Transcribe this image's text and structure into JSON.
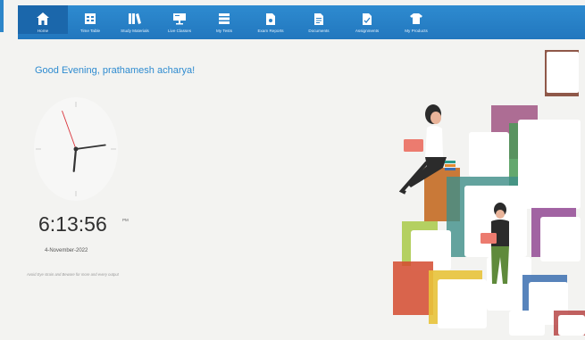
{
  "nav": {
    "items": [
      {
        "label": "Home",
        "icon": "home-icon",
        "active": true
      },
      {
        "label": "Time Table",
        "icon": "timetable-icon",
        "active": false
      },
      {
        "label": "Study Materials",
        "icon": "books-icon",
        "active": false
      },
      {
        "label": "Live Classes",
        "icon": "presentation-icon",
        "active": false
      },
      {
        "label": "My Tests",
        "icon": "tests-icon",
        "active": false
      },
      {
        "label": "Exam Reports",
        "icon": "report-icon",
        "active": false
      },
      {
        "label": "Documents",
        "icon": "document-icon",
        "active": false
      },
      {
        "label": "Assignments",
        "icon": "assignment-icon",
        "active": false
      },
      {
        "label": "My Products",
        "icon": "products-icon",
        "active": false
      }
    ]
  },
  "greeting": "Good Evening, prathamesh acharya!",
  "clock": {
    "time": "6:13:56",
    "ampm": "PM",
    "date": "4-November-2022",
    "hour": 6,
    "minute": 13,
    "second": 56
  },
  "note": "Avoid Eye strain and Beware for more and every output",
  "colors": {
    "nav": "#2e8bd0",
    "accent": "#2e8bd0",
    "background": "#f3f3f1"
  }
}
